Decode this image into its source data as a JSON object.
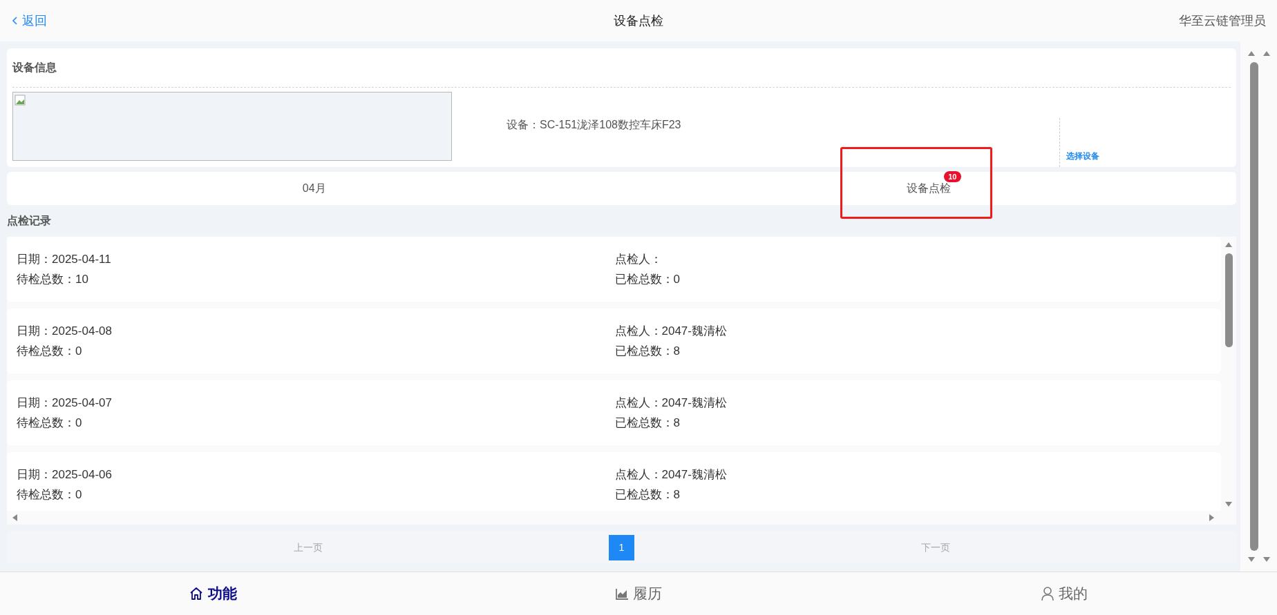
{
  "header": {
    "back_label": "返回",
    "title": "设备点检",
    "user": "华至云链管理员"
  },
  "device_info": {
    "title": "设备信息",
    "device_label": "设备：SC-151泷泽108数控车床F23",
    "select_link": "选择设备"
  },
  "tabs": [
    {
      "label": "04月"
    },
    {
      "label": "设备点检",
      "badge": "10",
      "highlighted": true
    }
  ],
  "section_title": "点检记录",
  "records": [
    {
      "date": "日期：2025-04-11",
      "pending": "待检总数：10",
      "inspector": "点检人：",
      "done": "已检总数：0"
    },
    {
      "date": "日期：2025-04-08",
      "pending": "待检总数：0",
      "inspector": "点检人：2047-魏清松",
      "done": "已检总数：8"
    },
    {
      "date": "日期：2025-04-07",
      "pending": "待检总数：0",
      "inspector": "点检人：2047-魏清松",
      "done": "已检总数：8"
    },
    {
      "date": "日期：2025-04-06",
      "pending": "待检总数：0",
      "inspector": "点检人：2047-魏清松",
      "done": "已检总数：8"
    }
  ],
  "pagination": {
    "prev": "上一页",
    "pages": [
      {
        "label": "1",
        "selected": true
      }
    ],
    "next": "下一页"
  },
  "nav": [
    {
      "kind": "home",
      "label": "功能",
      "selected": true
    },
    {
      "kind": "chart",
      "label": "履历",
      "selected": false
    },
    {
      "kind": "user",
      "label": "我的",
      "selected": false
    }
  ]
}
